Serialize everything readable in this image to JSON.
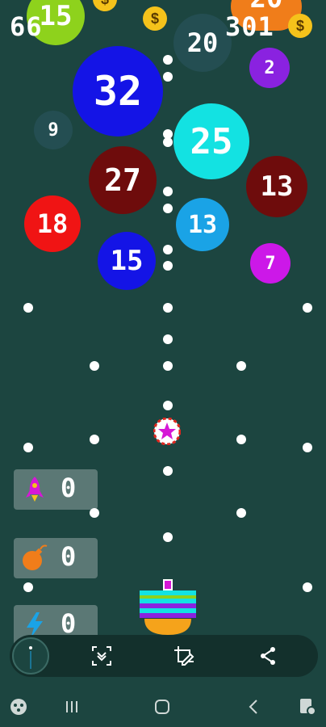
{
  "hud": {
    "left_score": "66",
    "right_score": "301"
  },
  "balls": [
    {
      "label": "15",
      "color": "#8ed21c"
    },
    {
      "label": "20",
      "color": "#f07d1a"
    },
    {
      "label": "20",
      "color": "#244e52"
    },
    {
      "label": "2",
      "color": "#8a22e0"
    },
    {
      "label": "32",
      "color": "#1414e6"
    },
    {
      "label": "9",
      "color": "#244e52"
    },
    {
      "label": "25",
      "color": "#13e2e2"
    },
    {
      "label": "27",
      "color": "#6e0c0c"
    },
    {
      "label": "13",
      "color": "#6e0c0c"
    },
    {
      "label": "18",
      "color": "#f01414"
    },
    {
      "label": "13",
      "color": "#1aa3e6"
    },
    {
      "label": "15",
      "color": "#1414e6"
    },
    {
      "label": "7",
      "color": "#cc18e8"
    }
  ],
  "powerups": [
    {
      "name": "rocket",
      "count": "0"
    },
    {
      "name": "bomb",
      "count": "0"
    },
    {
      "name": "lightning",
      "count": "0"
    }
  ],
  "coin_symbol": "$",
  "toolbar": {
    "icons": [
      "scroll-capture-icon",
      "edit-crop-icon",
      "share-icon"
    ]
  },
  "navbar": {
    "icons": [
      "game-launcher-icon",
      "recent-apps-icon",
      "home-icon",
      "back-icon",
      "game-tools-icon"
    ]
  }
}
